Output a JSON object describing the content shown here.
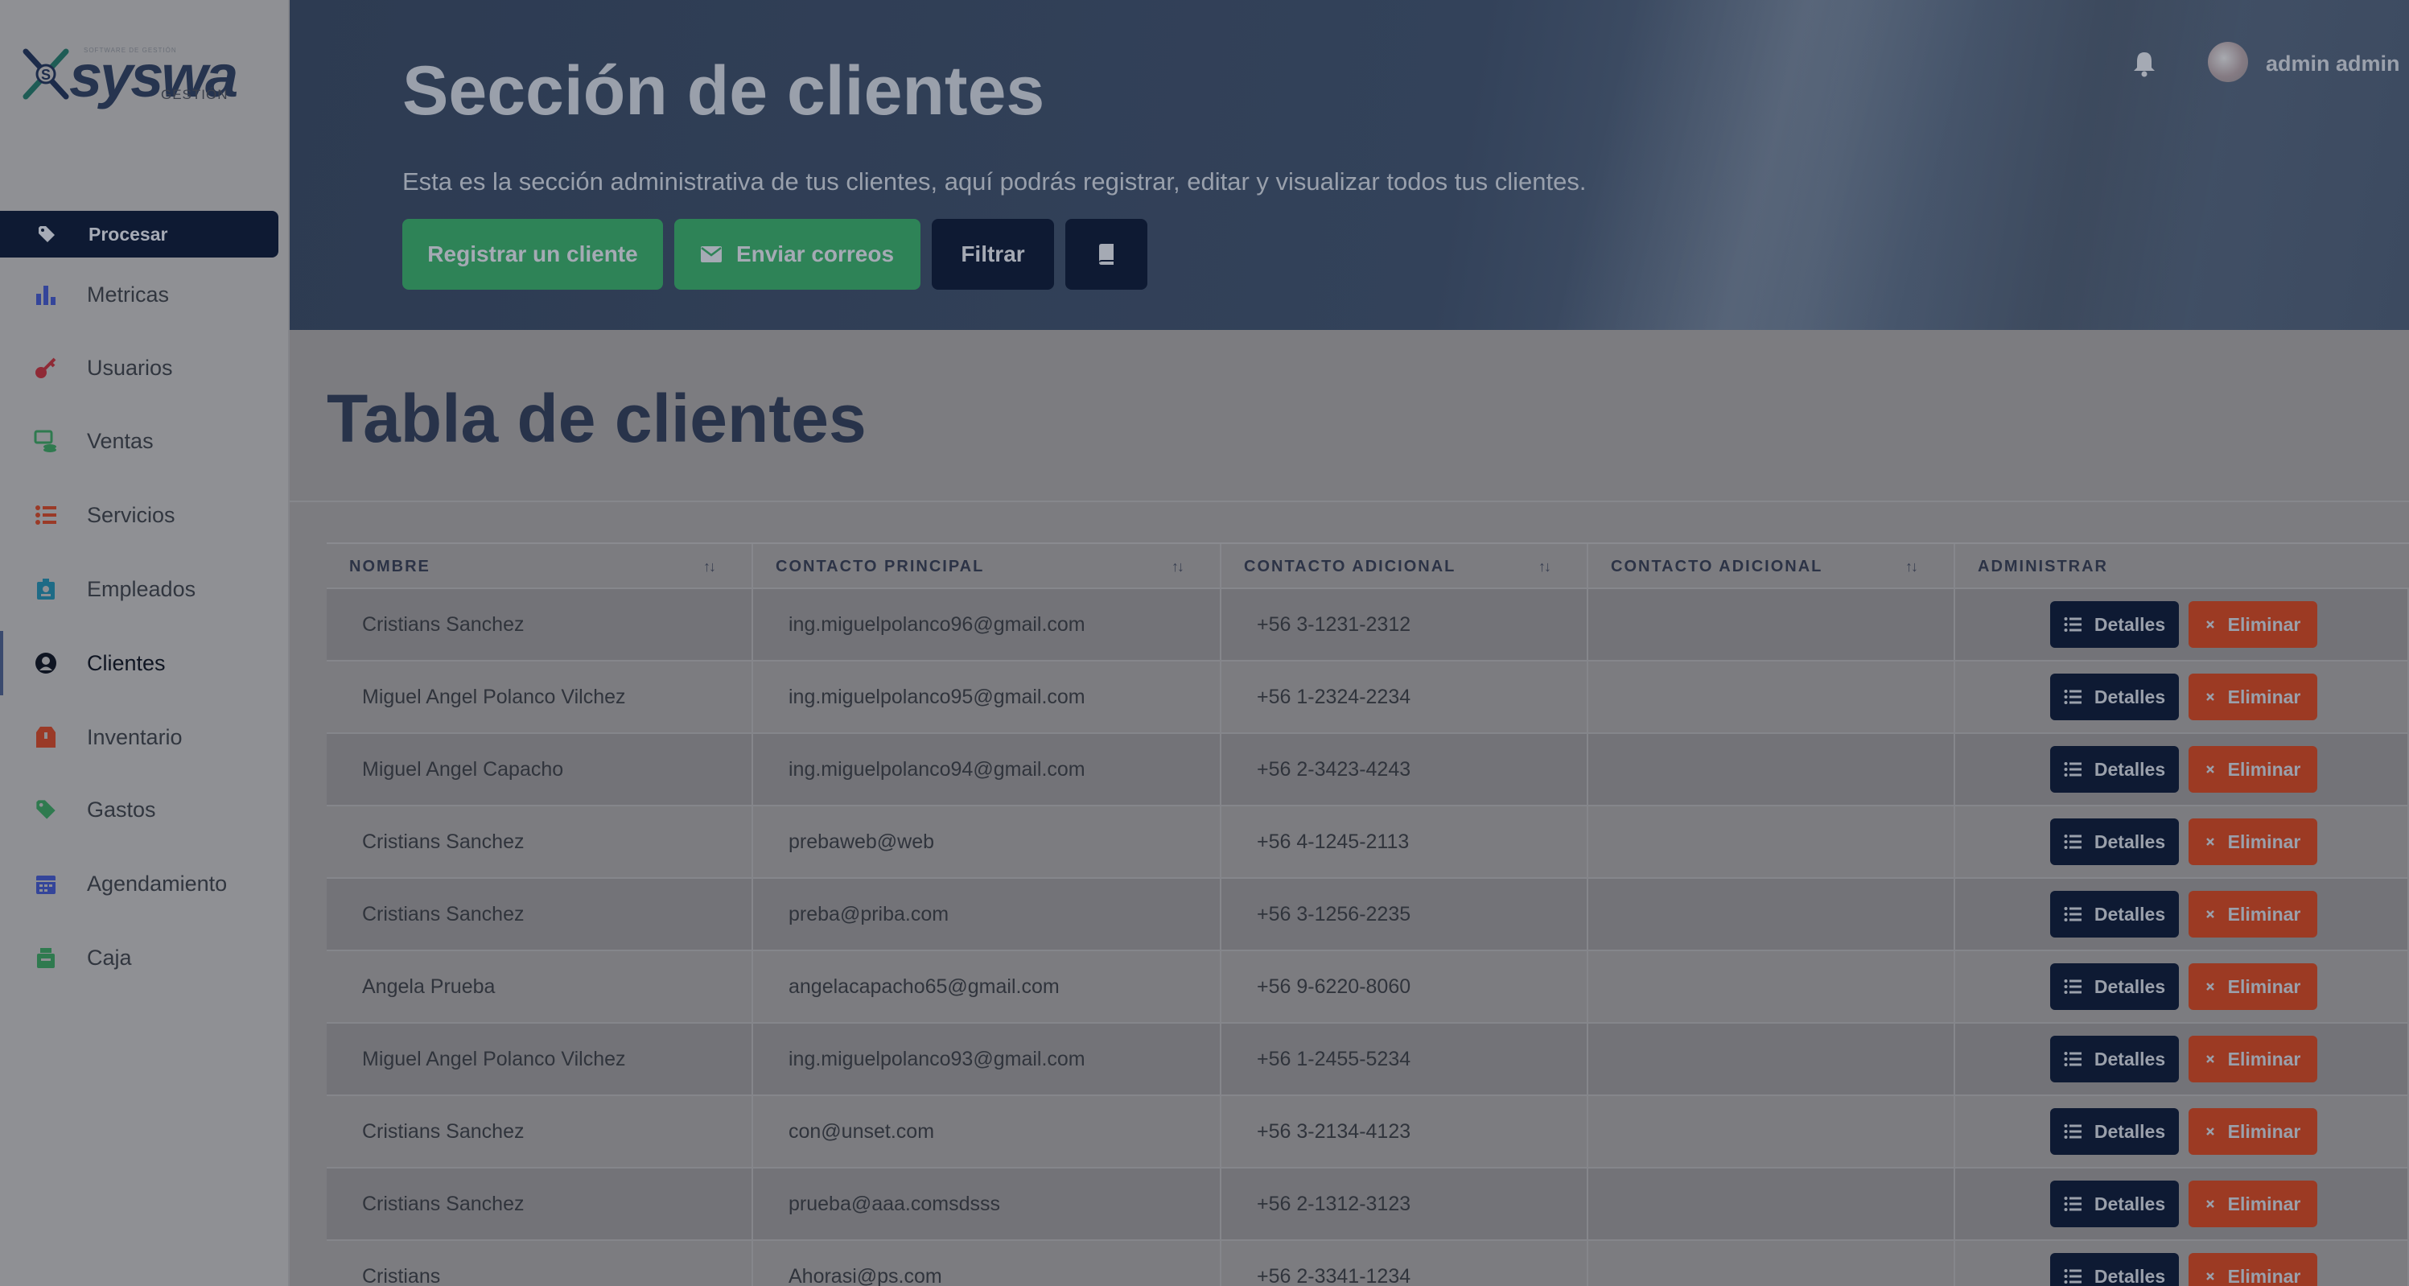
{
  "brand": {
    "name": "syswa",
    "sub": "GESTIÓN",
    "tag": "SOFTWARE DE GESTIÓN"
  },
  "sidebar": {
    "active": {
      "label": "Procesar",
      "icon": "tag-icon"
    },
    "items": [
      {
        "label": "Metricas",
        "icon": "bar-chart-icon"
      },
      {
        "label": "Usuarios",
        "icon": "key-icon"
      },
      {
        "label": "Ventas",
        "icon": "sales-icon"
      },
      {
        "label": "Servicios",
        "icon": "list-icon"
      },
      {
        "label": "Empleados",
        "icon": "id-badge-icon"
      },
      {
        "label": "Clientes",
        "icon": "user-circle-icon"
      },
      {
        "label": "Inventario",
        "icon": "box-icon"
      },
      {
        "label": "Gastos",
        "icon": "tag-icon"
      },
      {
        "label": "Agendamiento",
        "icon": "calendar-icon"
      },
      {
        "label": "Caja",
        "icon": "cash-register-icon"
      }
    ]
  },
  "header": {
    "title": "Sección de clientes",
    "description": "Esta es la sección administrativa de tus clientes, aquí podrás registrar, editar y visualizar todos tus clientes.",
    "buttons": {
      "register": "Registrar un cliente",
      "mail": "Enviar correos",
      "filter": "Filtrar"
    },
    "user": "admin admin"
  },
  "main": {
    "title": "Tabla de clientes",
    "columns": [
      "NOMBRE",
      "CONTACTO PRINCIPAL",
      "CONTACTO ADICIONAL",
      "CONTACTO ADICIONAL",
      "ADMINISTRAR"
    ],
    "sort_glyph": "↑↓",
    "action_labels": {
      "details": "Detalles",
      "delete": "Eliminar"
    },
    "rows": [
      {
        "name": "Cristians Sanchez",
        "email": "ing.miguelpolanco96@gmail.com",
        "phone": "+56 3-1231-2312",
        "extra": ""
      },
      {
        "name": "Miguel Angel Polanco Vilchez",
        "email": "ing.miguelpolanco95@gmail.com",
        "phone": "+56 1-2324-2234",
        "extra": ""
      },
      {
        "name": "Miguel Angel Capacho",
        "email": "ing.miguelpolanco94@gmail.com",
        "phone": "+56 2-3423-4243",
        "extra": ""
      },
      {
        "name": "Cristians Sanchez",
        "email": "prebaweb@web",
        "phone": "+56 4-1245-2113",
        "extra": ""
      },
      {
        "name": "Cristians Sanchez",
        "email": "preba@priba.com",
        "phone": "+56 3-1256-2235",
        "extra": ""
      },
      {
        "name": "Angela Prueba",
        "email": "angelacapacho65@gmail.com",
        "phone": "+56 9-6220-8060",
        "extra": ""
      },
      {
        "name": "Miguel Angel Polanco Vilchez",
        "email": "ing.miguelpolanco93@gmail.com",
        "phone": "+56 1-2455-5234",
        "extra": ""
      },
      {
        "name": "Cristians Sanchez",
        "email": "con@unset.com",
        "phone": "+56 3-2134-4123",
        "extra": ""
      },
      {
        "name": "Cristians Sanchez",
        "email": "prueba@aaa.comsdsss",
        "phone": "+56 2-1312-3123",
        "extra": ""
      },
      {
        "name": "Cristians",
        "email": "Ahorasi@ps.com",
        "phone": "+56 2-3341-1234",
        "extra": ""
      }
    ]
  },
  "colors": {
    "dark": "#0e1a33",
    "green": "#2e8357",
    "danger": "#9c3a23",
    "title": "#28334a"
  }
}
